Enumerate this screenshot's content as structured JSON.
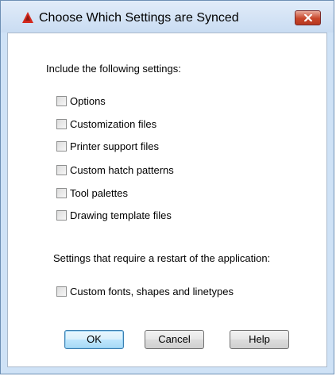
{
  "window": {
    "title": "Choose Which Settings are Synced"
  },
  "colors": {
    "title_gradient_top": "#e1ecf9",
    "close_button": "#c8462b",
    "app_icon": "#d3281d",
    "default_button_border": "#3c7fb1"
  },
  "icons": {
    "app": "autodesk-triangle-icon",
    "close": "close-x-icon"
  },
  "section1": {
    "heading": "Include the following settings:",
    "items": [
      {
        "label": "Options",
        "checked": false
      },
      {
        "label": "Customization files",
        "checked": false
      },
      {
        "label": "Printer support files",
        "checked": false
      },
      {
        "label": "Custom hatch patterns",
        "checked": false
      },
      {
        "label": "Tool palettes",
        "checked": false
      },
      {
        "label": "Drawing template files",
        "checked": false
      }
    ]
  },
  "section2": {
    "heading": "Settings that require a restart of the application:",
    "items": [
      {
        "label": "Custom fonts, shapes and linetypes",
        "checked": false
      }
    ]
  },
  "buttons": {
    "ok": "OK",
    "cancel": "Cancel",
    "help": "Help"
  }
}
